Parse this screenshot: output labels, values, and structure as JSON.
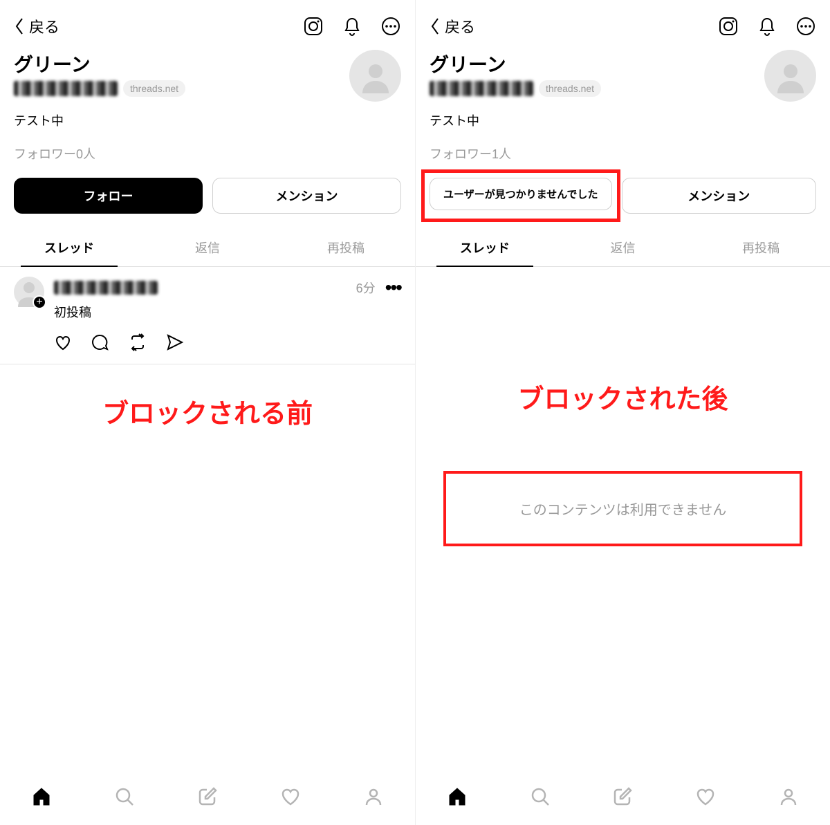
{
  "left": {
    "header": {
      "back": "戻る"
    },
    "profile": {
      "name": "グリーン",
      "badge": "threads.net",
      "bio": "テスト中",
      "followers": "フォロワー0人"
    },
    "buttons": {
      "primary": "フォロー",
      "secondary": "メンション"
    },
    "tabs": [
      "スレッド",
      "返信",
      "再投稿"
    ],
    "post": {
      "text": "初投稿",
      "time": "6分"
    },
    "caption": "ブロックされる前"
  },
  "right": {
    "header": {
      "back": "戻る"
    },
    "profile": {
      "name": "グリーン",
      "badge": "threads.net",
      "bio": "テスト中",
      "followers": "フォロワー1人"
    },
    "buttons": {
      "primary": "ユーザーが見つかりませんでした",
      "secondary": "メンション"
    },
    "tabs": [
      "スレッド",
      "返信",
      "再投稿"
    ],
    "caption": "ブロックされた後",
    "empty": "このコンテンツは利用できません"
  }
}
